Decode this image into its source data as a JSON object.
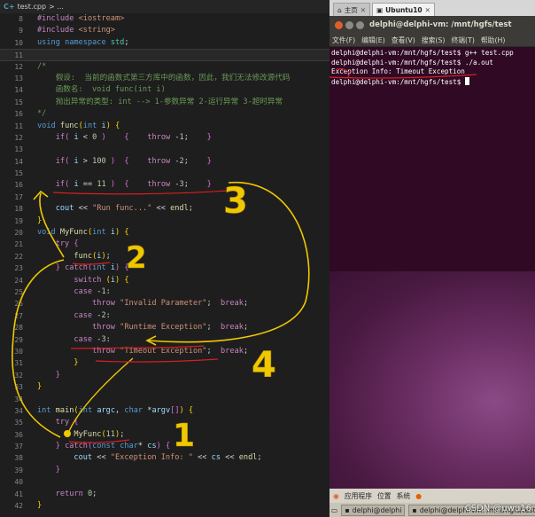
{
  "editor": {
    "tab": {
      "filename": "test.cpp",
      "breadcrumb": "> ..."
    },
    "lines": [
      {
        "n": "8",
        "html": "<span class='pp'>#include</span> <span class='st'>&lt;iostream&gt;</span>"
      },
      {
        "n": "9",
        "html": "<span class='pp'>#include</span> <span class='st'>&lt;string&gt;</span>"
      },
      {
        "n": "10",
        "html": "<span class='kw'>using</span> <span class='kw'>namespace</span> <span class='ty'>std</span>;"
      },
      {
        "n": "11",
        "html": "",
        "highlight": true
      },
      {
        "n": "12",
        "html": "<span class='cm'>/*</span>"
      },
      {
        "n": "13",
        "html": "<span class='cm'>    假设:  当前的函数式第三方库中的函数，因此，我们无法修改源代码</span>"
      },
      {
        "n": "14",
        "html": "<span class='cm'>    函数名:  void func(int i)</span>"
      },
      {
        "n": "15",
        "html": "<span class='cm'>    抛出异常的类型: int --&gt; 1-参数异常 2-运行异常 3-超时异常</span>"
      },
      {
        "n": "16",
        "html": "<span class='cm'>*/</span>"
      },
      {
        "n": "11",
        "html": "<span class='kw'>void</span> <span class='fn'>func</span><span class='yl'>(</span><span class='kw'>int</span> <span class='va'>i</span><span class='yl'>)</span> <span class='yl'>{</span>"
      },
      {
        "n": "12",
        "html": "    <span class='ct'>if</span><span class='pk'>(</span> <span class='va'>i</span> &lt; <span class='nm'>0</span> <span class='pk'>)</span>    <span class='pk'>{</span>    <span class='ct'>throw</span> -<span class='nm'>1</span>;    <span class='pk'>}</span>"
      },
      {
        "n": "13",
        "html": ""
      },
      {
        "n": "14",
        "html": "    <span class='ct'>if</span><span class='pk'>(</span> <span class='va'>i</span> &gt; <span class='nm'>100</span> <span class='pk'>)</span>  <span class='pk'>{</span>    <span class='ct'>throw</span> -<span class='nm'>2</span>;    <span class='pk'>}</span>"
      },
      {
        "n": "15",
        "html": ""
      },
      {
        "n": "16",
        "html": "    <span class='ct'>if</span><span class='pk'>(</span> <span class='va'>i</span> == <span class='nm'>11</span> <span class='pk'>)</span>  <span class='pk'>{</span>    <span class='ct'>throw</span> -<span class='nm'>3</span>;    <span class='pk'>}</span>"
      },
      {
        "n": "17",
        "html": ""
      },
      {
        "n": "18",
        "html": "    <span class='va'>cout</span> &lt;&lt; <span class='st'>\"Run func...\"</span> &lt;&lt; <span class='fn'>endl</span>;"
      },
      {
        "n": "19",
        "html": "<span class='yl'>}</span>"
      },
      {
        "n": "20",
        "html": "<span class='kw'>void</span> <span class='fn'>MyFunc</span><span class='yl'>(</span><span class='kw'>int</span> <span class='va'>i</span><span class='yl'>)</span> <span class='yl'>{</span>"
      },
      {
        "n": "21",
        "html": "    <span class='ct'>try</span> <span class='pk'>{</span>"
      },
      {
        "n": "22",
        "html": "        <span class='fn'>func</span><span class='yl'>(</span><span class='va'>i</span><span class='yl'>)</span>;"
      },
      {
        "n": "23",
        "html": "    <span class='pk'>}</span> <span class='ct'>catch</span><span class='pk'>(</span><span class='kw'>int</span> <span class='va'>i</span><span class='pk'>)</span> <span class='pk'>{</span>"
      },
      {
        "n": "24",
        "html": "        <span class='ct'>switch</span> <span class='yl'>(</span><span class='va'>i</span><span class='yl'>)</span> <span class='yl'>{</span>"
      },
      {
        "n": "25",
        "html": "        <span class='ct'>case</span> -<span class='nm'>1</span>:"
      },
      {
        "n": "26",
        "html": "            <span class='ct'>throw</span> <span class='st'>\"Invalid Parameter\"</span>;  <span class='ct'>break</span>;"
      },
      {
        "n": "27",
        "html": "        <span class='ct'>case</span> -<span class='nm'>2</span>:"
      },
      {
        "n": "28",
        "html": "            <span class='ct'>throw</span> <span class='st'>\"Runtime Exception\"</span>;  <span class='ct'>break</span>;"
      },
      {
        "n": "29",
        "html": "        <span class='ct'>case</span> -<span class='nm'>3</span>:"
      },
      {
        "n": "30",
        "html": "            <span class='ct'>throw</span> <span class='st'>\"Timeout Exception\"</span>;  <span class='ct'>break</span>;"
      },
      {
        "n": "31",
        "html": "        <span class='yl'>}</span>"
      },
      {
        "n": "32",
        "html": "    <span class='pk'>}</span>"
      },
      {
        "n": "33",
        "html": "<span class='yl'>}</span>"
      },
      {
        "n": "34",
        "html": ""
      },
      {
        "n": "34",
        "html": "<span class='kw'>int</span> <span class='fn'>main</span><span class='yl'>(</span><span class='kw'>int</span> <span class='va'>argc</span>, <span class='kw'>char</span> *<span class='va'>argv</span><span class='pk'>[]</span><span class='yl'>)</span> <span class='yl'>{</span>"
      },
      {
        "n": "35",
        "html": "    <span class='ct'>try</span> <span class='pk'>{</span>"
      },
      {
        "n": "36",
        "html": "        <span class='fn'>MyFunc</span><span class='yl'>(</span><span class='nm'>11</span><span class='yl'>)</span>;"
      },
      {
        "n": "37",
        "html": "    <span class='pk'>}</span> <span class='ct'>catch</span><span class='pk'>(</span><span class='kw'>const</span> <span class='kw'>char</span>* <span class='va'>cs</span><span class='pk'>)</span> <span class='pk'>{</span>"
      },
      {
        "n": "38",
        "html": "        <span class='va'>cout</span> &lt;&lt; <span class='st'>\"Exception Info: \"</span> &lt;&lt; <span class='va'>cs</span> &lt;&lt; <span class='fn'>endl</span>;"
      },
      {
        "n": "39",
        "html": "    <span class='pk'>}</span>"
      },
      {
        "n": "40",
        "html": ""
      },
      {
        "n": "41",
        "html": "    <span class='ct'>return</span> <span class='nm'>0</span>;"
      },
      {
        "n": "42",
        "html": "<span class='yl'>}</span>"
      }
    ]
  },
  "annotations": {
    "labels": [
      "1",
      "2",
      "3",
      "4"
    ]
  },
  "vm": {
    "tabs": [
      {
        "label": "主页"
      },
      {
        "label": "Ubuntu10",
        "active": true
      }
    ]
  },
  "terminal": {
    "title": "delphi@delphi-vm: /mnt/hgfs/test",
    "menu": [
      "文件(F)",
      "编辑(E)",
      "查看(V)",
      "搜索(S)",
      "终端(T)",
      "帮助(H)"
    ],
    "output": [
      "delphi@delphi-vm:/mnt/hgfs/test$ g++ test.cpp",
      "delphi@delphi-vm:/mnt/hgfs/test$ ./a.out",
      "Exception Info: Timeout Exception",
      "delphi@delphi-vm:/mnt/hgfs/test$ "
    ]
  },
  "panel": {
    "menu": [
      "应用程序",
      "位置",
      "系统"
    ],
    "tasks": [
      "delphi@delphi",
      "delphi@delphi-vm: /mnt/hgfs/test"
    ]
  },
  "watermark": "CSDN @uwu16"
}
